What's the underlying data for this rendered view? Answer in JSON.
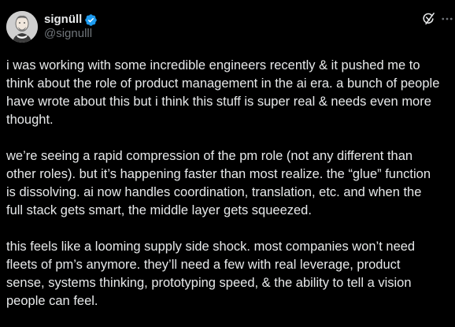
{
  "author": {
    "display_name": "signüll",
    "handle": "@signulll",
    "verified_icon": "verified-badge-icon",
    "avatar_icon": "avatar-portrait-icon"
  },
  "actions": {
    "grok_icon": "grok-icon",
    "more_icon": "more-icon"
  },
  "colors": {
    "background": "#000000",
    "text": "#e7e9ea",
    "handle": "#71767b",
    "verified": "#1d9bf0"
  },
  "tweet": {
    "paragraphs": [
      "i was working with some incredible engineers recently & it pushed me to think about the role of product management in the ai era. a bunch of people have wrote about this but i think this stuff is super real & needs even more thought.",
      "we’re seeing a rapid compression of the pm role (not any different than other roles). but it’s happening faster than most realize. the “glue” function is dissolving. ai now handles coordination, translation, etc. and when the full stack gets smart, the middle layer gets squeezed.",
      "this feels like a looming supply side shock. most companies won’t need fleets of pm’s anymore. they’ll need a few with real leverage, product sense, systems thinking, prototyping speed, & the ability to tell a vision people can feel."
    ]
  }
}
